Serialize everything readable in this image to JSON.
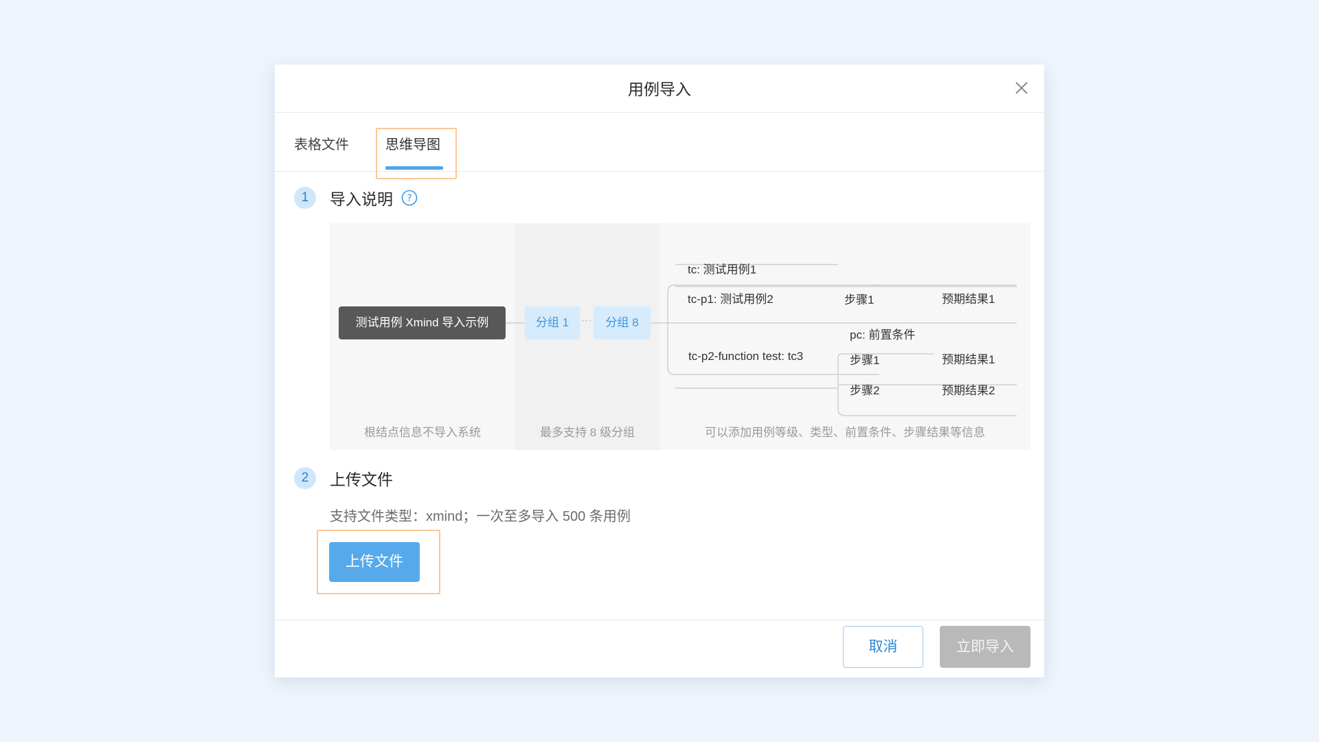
{
  "dialog": {
    "title": "用例导入"
  },
  "tabs": [
    {
      "label": "表格文件",
      "active": false
    },
    {
      "label": "思维导图",
      "active": true
    }
  ],
  "colors": {
    "accent": "#4fa3ea",
    "highlight": "#f9c895",
    "page_background": "#edf4fc"
  },
  "section1": {
    "number": "1",
    "title": "导入说明",
    "icon": "help-circle-icon"
  },
  "example": {
    "root": "测试用例 Xmind 导入示例",
    "group_first": "分组 1",
    "ellipsis": "···",
    "group_last": "分组 8",
    "case1": "tc: 测试用例1",
    "case2": "tc-p1: 测试用例2",
    "case2_step": "步骤1",
    "case2_result": "预期结果1",
    "case3_precondition": "pc: 前置条件",
    "case3": "tc-p2-function test: tc3",
    "case3_step1": "步骤1",
    "case3_result1": "预期结果1",
    "case3_step2": "步骤2",
    "case3_result2": "预期结果2",
    "caption_root": "根结点信息不导入系统",
    "caption_groups": "最多支持 8 级分组",
    "caption_cases": "可以添加用例等级、类型、前置条件、步骤结果等信息"
  },
  "section2": {
    "number": "2",
    "title": "上传文件",
    "description": "支持文件类型：xmind；一次至多导入 500 条用例",
    "upload_label": "上传文件"
  },
  "footer": {
    "cancel_label": "取消",
    "import_label": "立即导入"
  }
}
